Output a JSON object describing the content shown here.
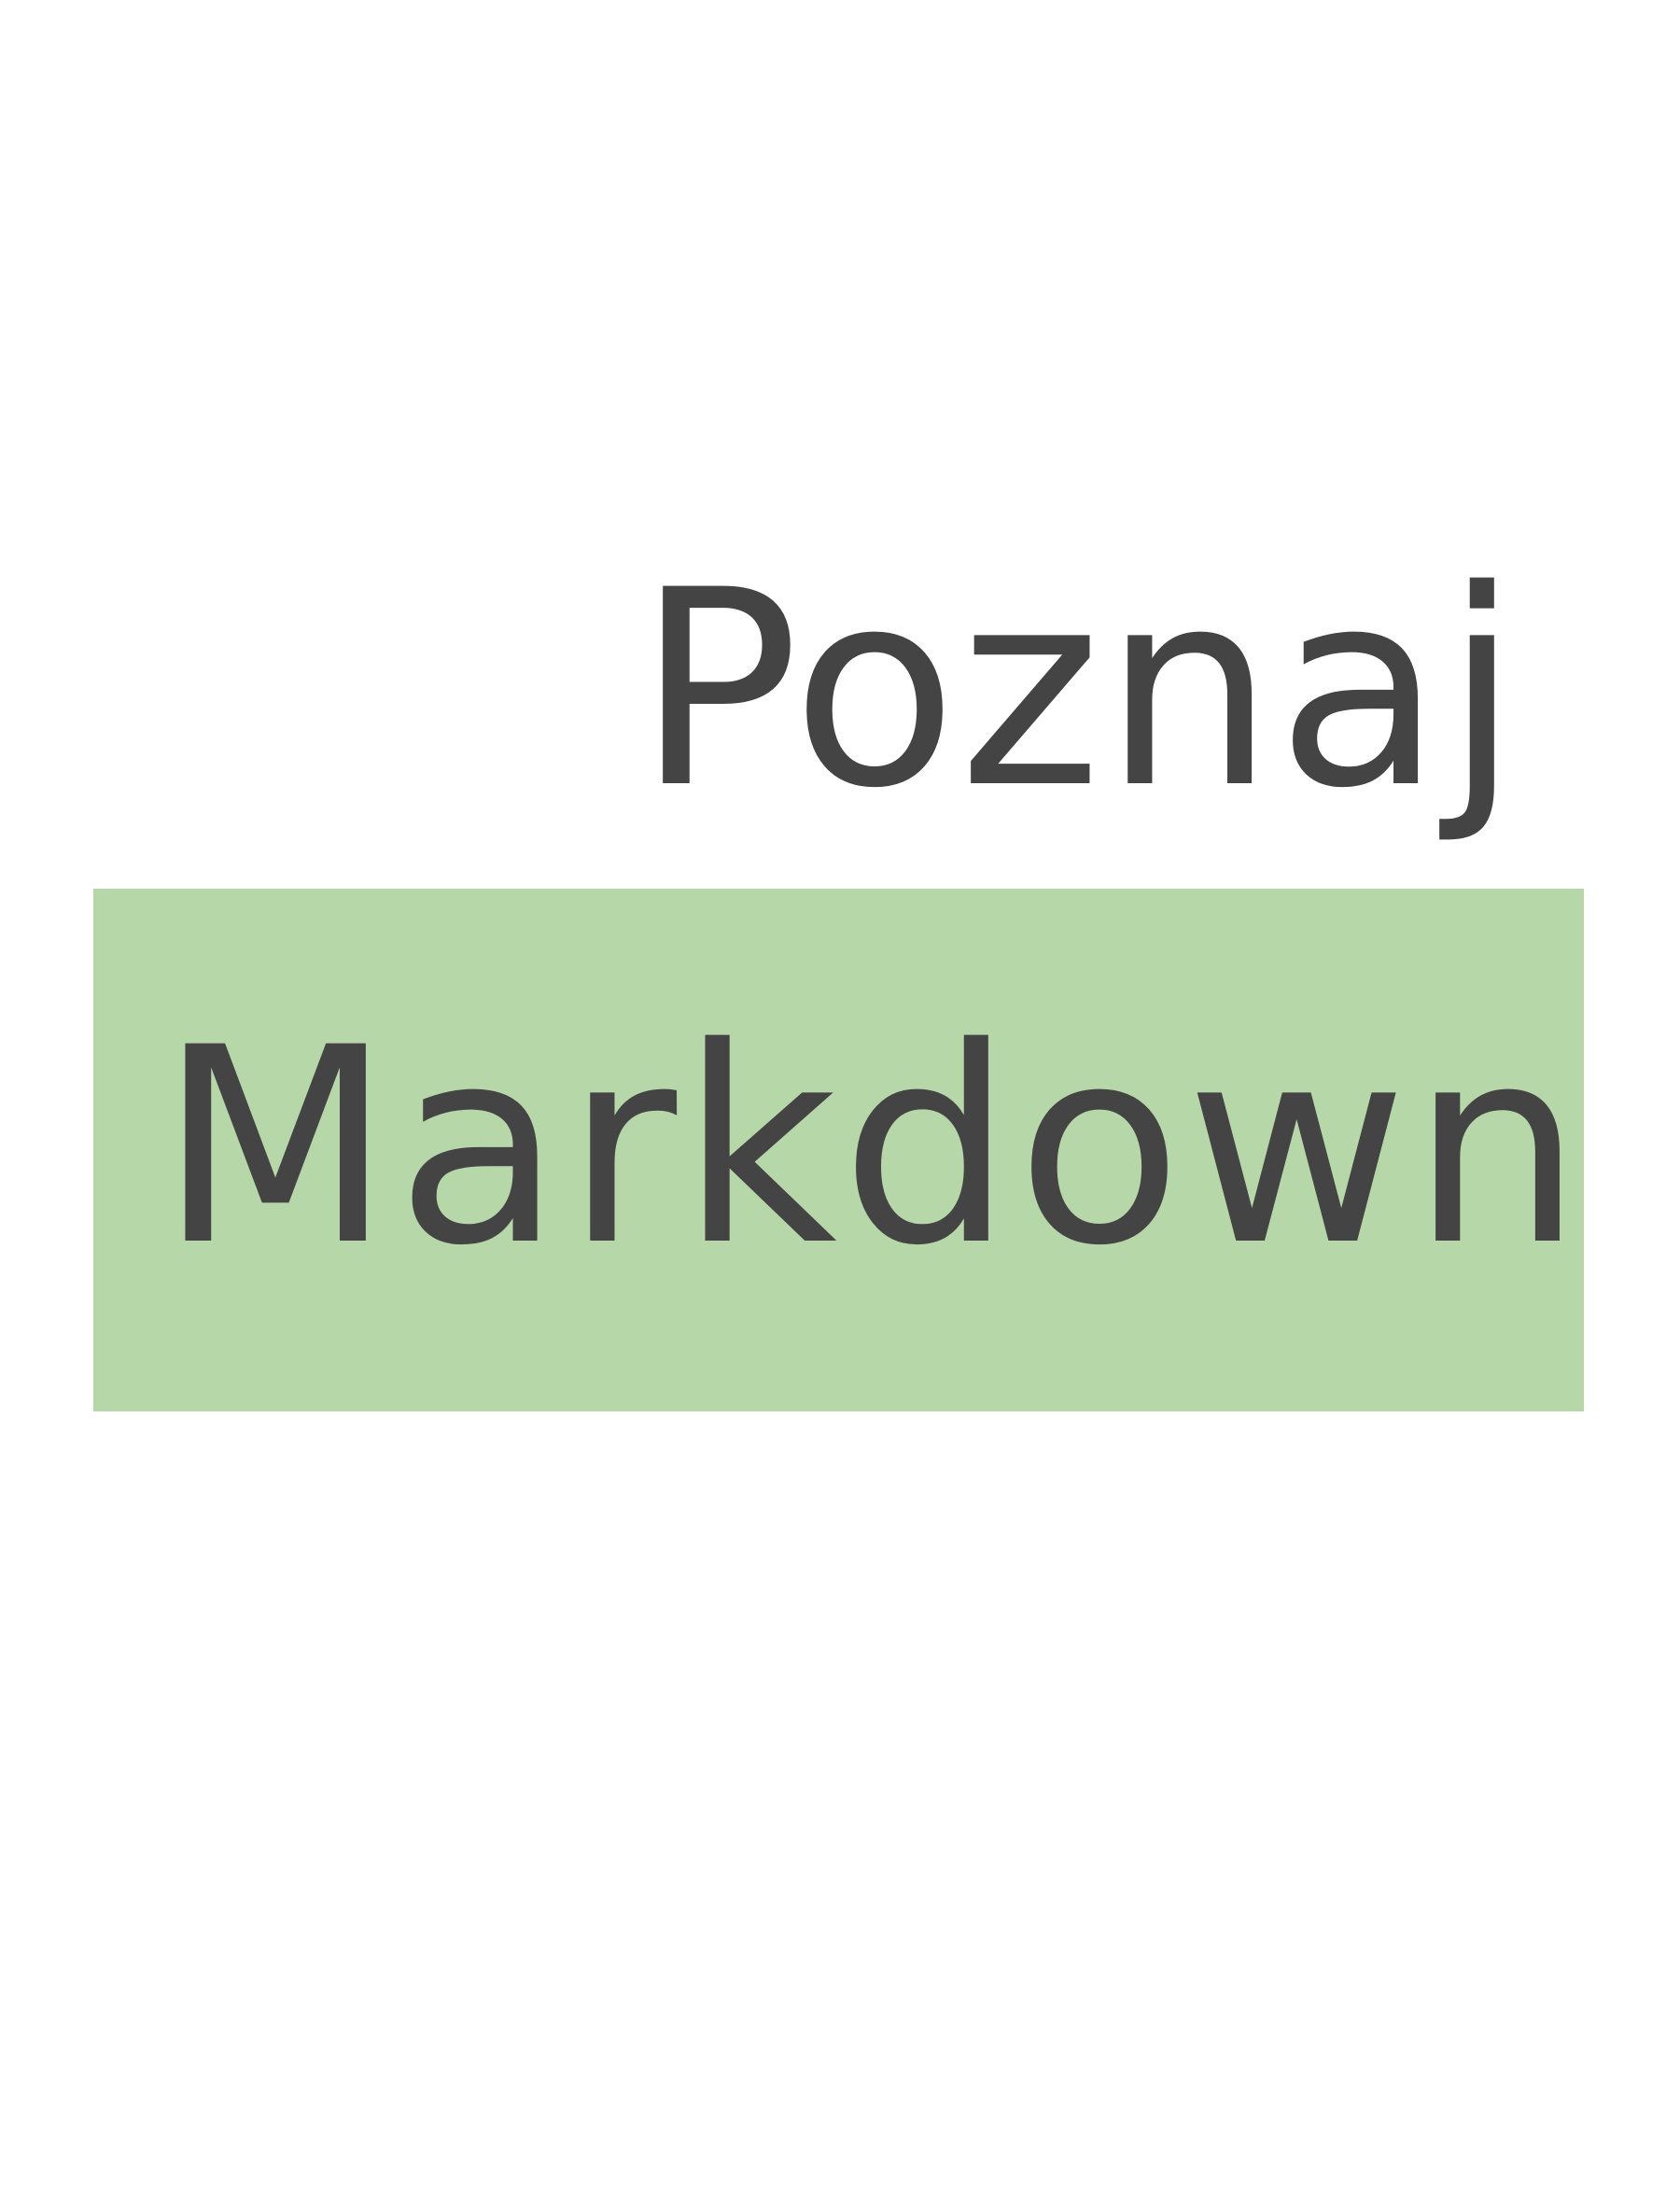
{
  "cover": {
    "title_line_1": "Poznaj",
    "title_line_2": "Markdown",
    "band_color": "#b6d7a8",
    "text_color": "#444444"
  }
}
